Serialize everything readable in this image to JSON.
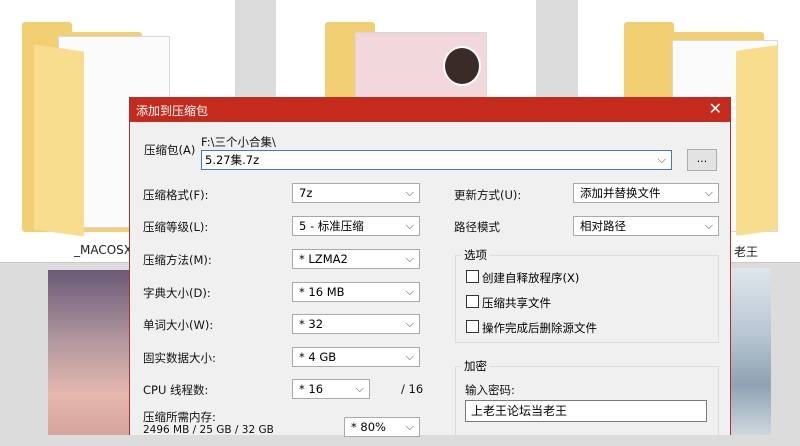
{
  "background": {
    "folder_labels": [
      "_MACOSX",
      "老王"
    ]
  },
  "dialog": {
    "title": "添加到压缩包",
    "close_glyph": "✕",
    "archive_label": "压缩包(A)",
    "archive_path": "F:\\三个小合集\\",
    "archive_name": "5.27集.7z",
    "browse_label": "...",
    "format_label": "压缩格式(F):",
    "format_value": "7z",
    "level_label": "压缩等级(L):",
    "level_value": "5 - 标准压缩",
    "method_label": "压缩方法(M):",
    "method_value": "* LZMA2",
    "dict_label": "字典大小(D):",
    "dict_value": "* 16 MB",
    "word_label": "单词大小(W):",
    "word_value": "* 32",
    "solid_label": "固实数据大小:",
    "solid_value": "* 4 GB",
    "cpu_label": "CPU 线程数:",
    "cpu_value": "* 16",
    "cpu_total": "/ 16",
    "memory_label": "压缩所需内存:",
    "memory_value": "2496 MB / 25 GB / 32 GB",
    "memory_percent": "* 80%",
    "update_label": "更新方式(U):",
    "update_value": "添加并替换文件",
    "path_label": "路径模式",
    "path_value": "相对路径",
    "options_title": "选项",
    "opt_sfx": "创建自释放程序(X)",
    "opt_shared": "压缩共享文件",
    "opt_delete": "操作完成后删除源文件",
    "encrypt_title": "加密",
    "password_label": "输入密码:",
    "password_value": "上老王论坛当老王"
  },
  "colors": {
    "titlebar": "#c42b1c",
    "folder": "#f3cf73"
  }
}
